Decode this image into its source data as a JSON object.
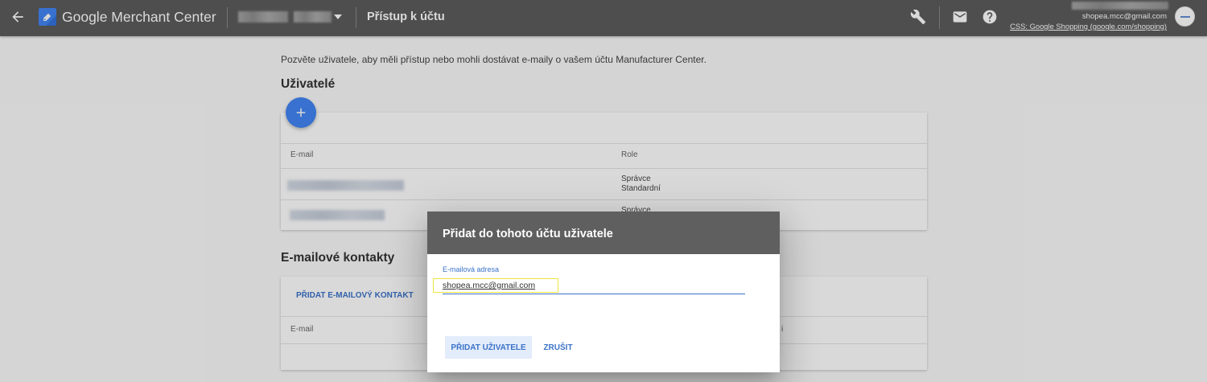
{
  "topbar": {
    "app_name": "Google Merchant Center",
    "page_title": "Přístup k účtu",
    "user_email": "shopea.mcc@gmail.com",
    "account_link": "CSS: Google Shopping (google.com/shopping)",
    "icons": {
      "back": "back-arrow-icon",
      "logo": "merchant-center-logo",
      "account_menu": "dropdown-caret-icon",
      "tools": "wrench-icon",
      "messages": "mail-icon",
      "help": "help-icon"
    }
  },
  "main": {
    "intro": "Pozvěte uživatele, aby měli přístup nebo mohli dostávat e-maily o vašem účtu Manufacturer Center.",
    "users": {
      "title": "Uživatelé",
      "add_icon": "add-icon",
      "columns": {
        "email": "E-mail",
        "role": "Role"
      },
      "rows": [
        {
          "roles": [
            "Správce",
            "Standardní"
          ]
        },
        {
          "roles": [
            "Správce"
          ]
        }
      ]
    },
    "contacts": {
      "title": "E-mailové kontakty",
      "add_label": "PŘIDAT E-MAILOVÝ KONTAKT",
      "columns": {
        "email": "E-mail",
        "second": "i"
      }
    }
  },
  "dialog": {
    "title": "Přidat do tohoto účtu uživatele",
    "field_label": "E-mailová adresa",
    "field_value": "shopea.mcc@gmail.com",
    "submit_label": "PŘIDAT UŽIVATELE",
    "cancel_label": "ZRUŠIT"
  },
  "colors": {
    "topbar_bg": "#5c5c5c",
    "accent_blue": "#4285f4",
    "link_blue": "#3b73c9",
    "dialog_header_bg": "#5f5f5f",
    "highlight": "#f0e442",
    "scrim": "rgba(0,0,0,0.15)"
  }
}
